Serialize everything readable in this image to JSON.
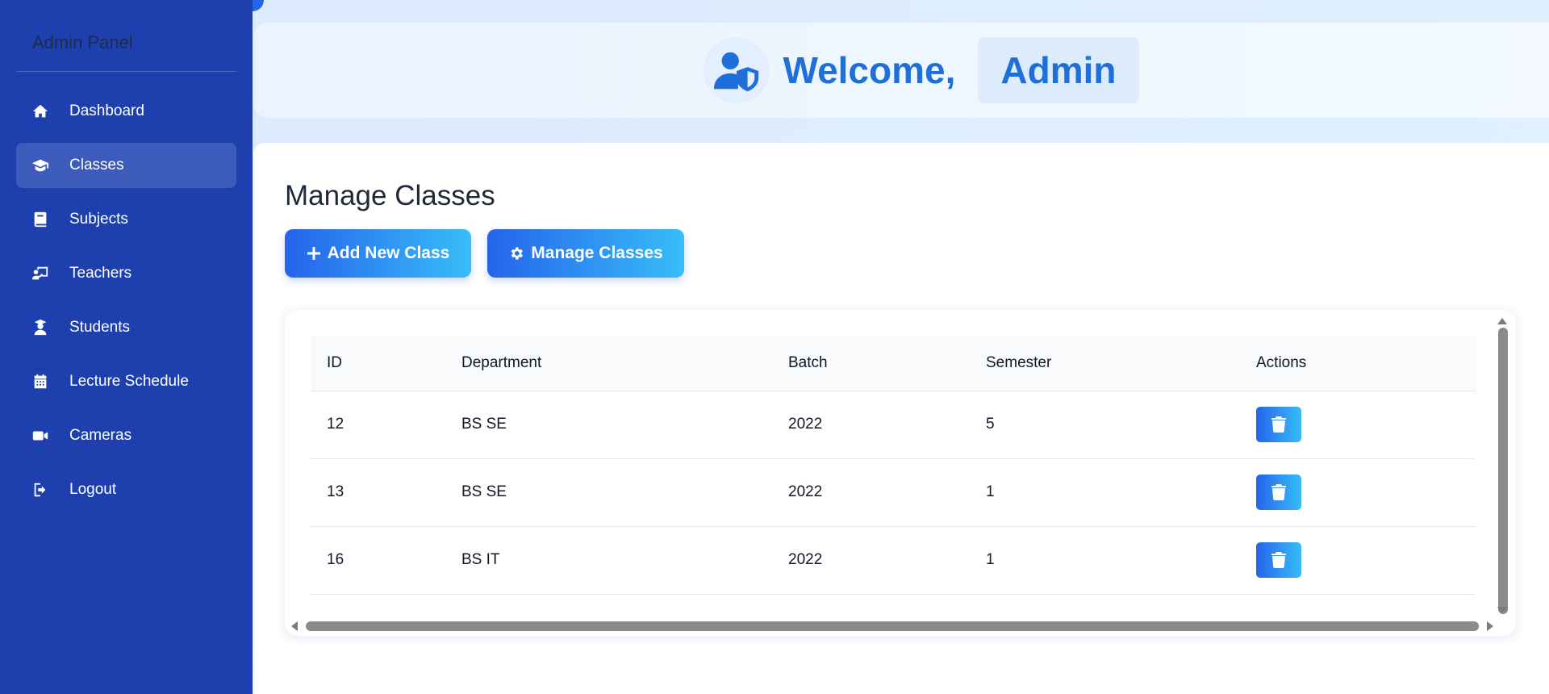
{
  "sidebar": {
    "title": "Admin Panel",
    "items": [
      {
        "label": "Dashboard",
        "icon": "home-icon",
        "active": false
      },
      {
        "label": "Classes",
        "icon": "graduation-cap-icon",
        "active": true
      },
      {
        "label": "Subjects",
        "icon": "book-icon",
        "active": false
      },
      {
        "label": "Teachers",
        "icon": "chalkboard-teacher-icon",
        "active": false
      },
      {
        "label": "Students",
        "icon": "user-graduate-icon",
        "active": false
      },
      {
        "label": "Lecture Schedule",
        "icon": "calendar-icon",
        "active": false
      },
      {
        "label": "Cameras",
        "icon": "video-camera-icon",
        "active": false
      },
      {
        "label": "Logout",
        "icon": "sign-out-icon",
        "active": false
      }
    ]
  },
  "header": {
    "welcome": "Welcome,",
    "user": "Admin",
    "icon": "user-shield-icon"
  },
  "main": {
    "title": "Manage Classes",
    "add_button": "Add New Class",
    "manage_button": "Manage Classes"
  },
  "table": {
    "columns": [
      "ID",
      "Department",
      "Batch",
      "Semester",
      "Actions"
    ],
    "rows": [
      {
        "id": "12",
        "department": "BS SE",
        "batch": "2022",
        "semester": "5"
      },
      {
        "id": "13",
        "department": "BS SE",
        "batch": "2022",
        "semester": "1"
      },
      {
        "id": "16",
        "department": "BS IT",
        "batch": "2022",
        "semester": "1"
      }
    ]
  },
  "colors": {
    "sidebar_bg": "#1e40af",
    "accent": "#1e6fd9",
    "button_start": "#2563eb",
    "button_end": "#38bdf8"
  }
}
